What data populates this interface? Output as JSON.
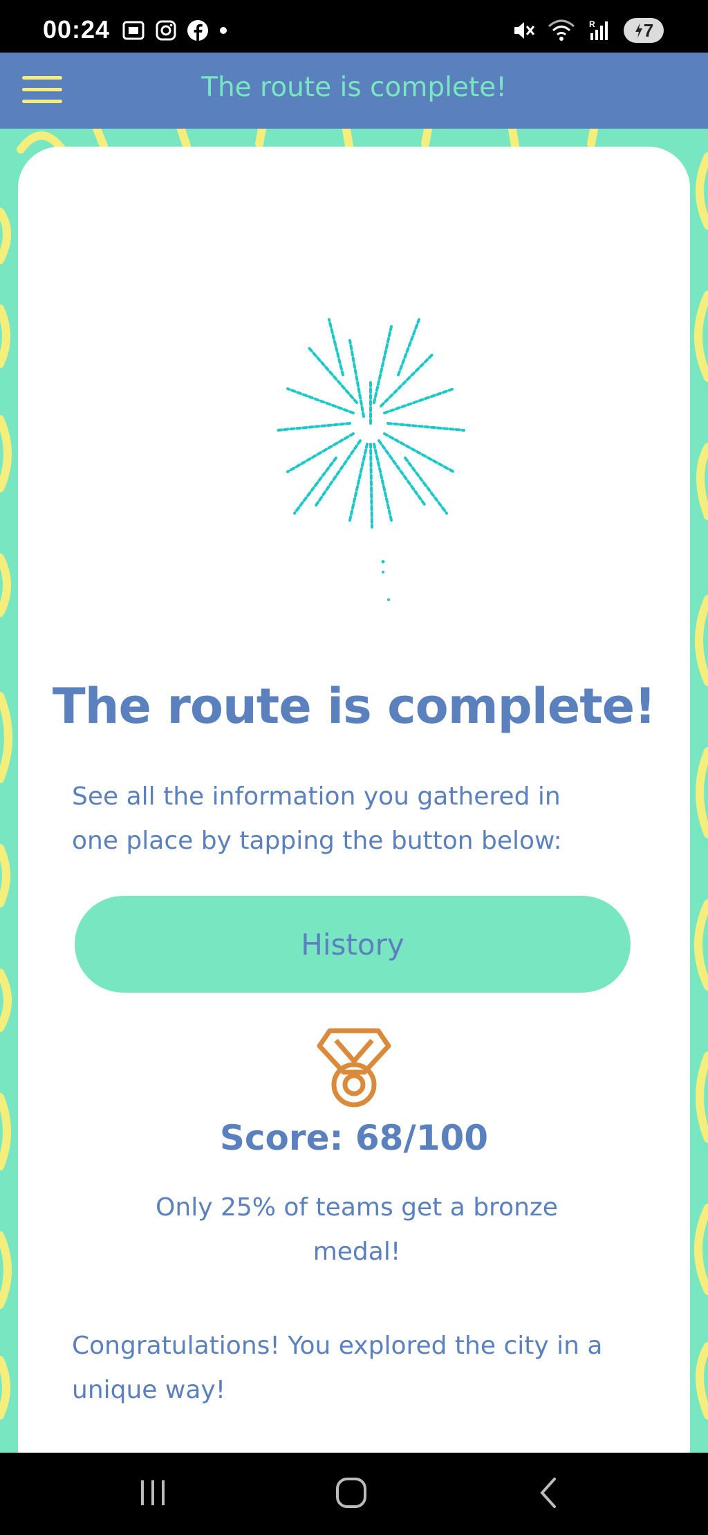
{
  "status_bar": {
    "time": "00:24",
    "battery": "7",
    "left_icons": [
      "screenshot-icon",
      "instagram-icon",
      "facebook-icon",
      "dot-icon"
    ],
    "right_icons": [
      "mute-icon",
      "wifi-icon",
      "signal-icon"
    ]
  },
  "app_bar": {
    "title": "The route is complete!",
    "menu_icon": "hamburger-menu-icon"
  },
  "colors": {
    "primary_blue": "#5a80bd",
    "mint": "#79e6c2",
    "yellow": "#f4ef7c",
    "firework": "#1fc8c8",
    "medal": "#d98a3a"
  },
  "main": {
    "heading": "The route is complete!",
    "info_line1": "See all the information you gathered in",
    "info_line2": "one place by tapping the button below:",
    "history_button": "History",
    "medal_icon": "bronze-medal-icon",
    "score": "Score: 68/100",
    "score_note_line1": "Only 25% of teams get a bronze",
    "score_note_line2": "medal!",
    "congrats_line1": "Congratulations! You explored the city in a",
    "congrats_line2": "unique way!"
  },
  "nav_bar": {
    "icons": [
      "recent-apps-icon",
      "home-icon",
      "back-icon"
    ]
  }
}
